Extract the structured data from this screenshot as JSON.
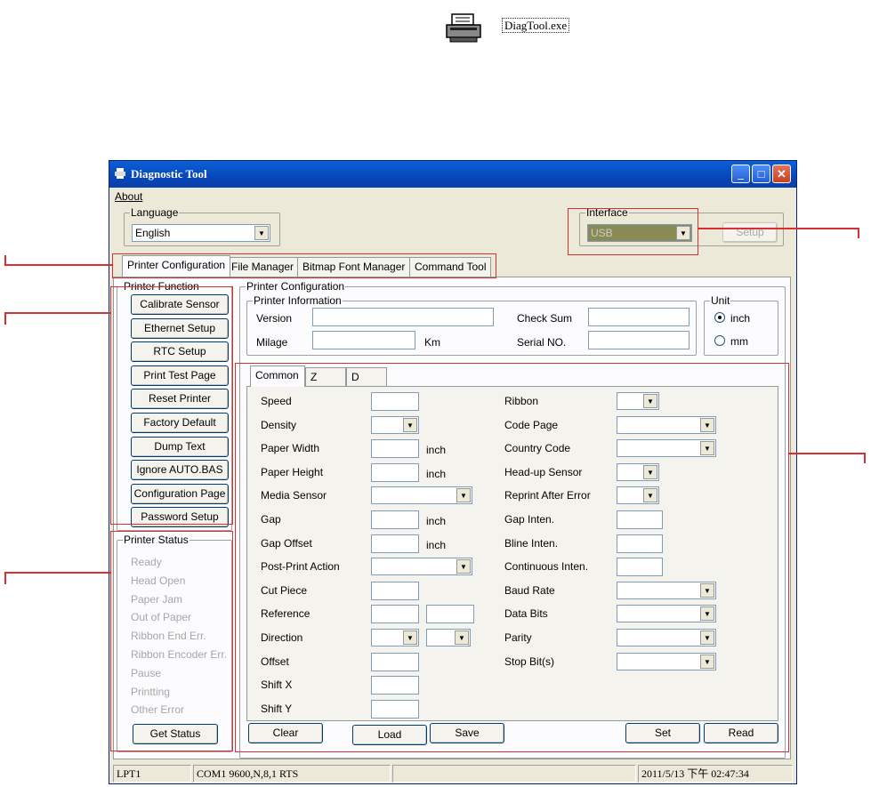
{
  "desktop": {
    "icon": "printer-icon",
    "label": "DiagTool.exe"
  },
  "window": {
    "title": "Diagnostic Tool",
    "menu": {
      "about": "About"
    },
    "language": {
      "label": "Language",
      "value": "English"
    },
    "interface": {
      "label": "Interface",
      "value": "USB",
      "setup": "Setup"
    },
    "tabs": [
      "Printer Configuration",
      "File Manager",
      "Bitmap Font Manager",
      "Command Tool"
    ],
    "printer_function": {
      "label": "Printer Function",
      "buttons": [
        "Calibrate Sensor",
        "Ethernet Setup",
        "RTC Setup",
        "Print Test Page",
        "Reset Printer",
        "Factory Default",
        "Dump Text",
        "Ignore AUTO.BAS",
        "Configuration Page",
        "Password Setup"
      ]
    },
    "printer_status": {
      "label": "Printer Status",
      "items": [
        "Ready",
        "Head Open",
        "Paper Jam",
        "Out of Paper",
        "Ribbon End Err.",
        "Ribbon Encoder Err.",
        "Pause",
        "Printting",
        "Other Error"
      ],
      "get_status": "Get Status"
    },
    "printer_config": {
      "label": "Printer Configuration",
      "info_label": "Printer Information",
      "version": "Version",
      "milage": "Milage",
      "km": "Km",
      "checksum": "Check Sum",
      "serial": "Serial NO.",
      "unit": {
        "label": "Unit",
        "inch": "inch",
        "mm": "mm"
      },
      "subtabs": [
        "Common",
        "Z",
        "D"
      ],
      "left_fields": [
        "Speed",
        "Density",
        "Paper Width",
        "Paper Height",
        "Media Sensor",
        "Gap",
        "Gap Offset",
        "Post-Print Action",
        "Cut Piece",
        "Reference",
        "Direction",
        "Offset",
        "Shift X",
        "Shift Y"
      ],
      "inch": "inch",
      "right_fields": [
        "Ribbon",
        "Code Page",
        "Country Code",
        "Head-up Sensor",
        "Reprint After Error",
        "Gap Inten.",
        "Bline Inten.",
        "Continuous Inten.",
        "Baud Rate",
        "Data Bits",
        "Parity",
        "Stop Bit(s)"
      ],
      "bottom_buttons": {
        "clear": "Clear",
        "load": "Load",
        "save": "Save",
        "set": "Set",
        "read": "Read"
      }
    },
    "statusbar": {
      "port": "LPT1",
      "com": "COM1 9600,N,8,1 RTS",
      "middle": "",
      "datetime": "2011/5/13 下午 02:47:34"
    }
  },
  "colors": {
    "annotation": "#d63030",
    "titlebar": "#0847b9"
  }
}
